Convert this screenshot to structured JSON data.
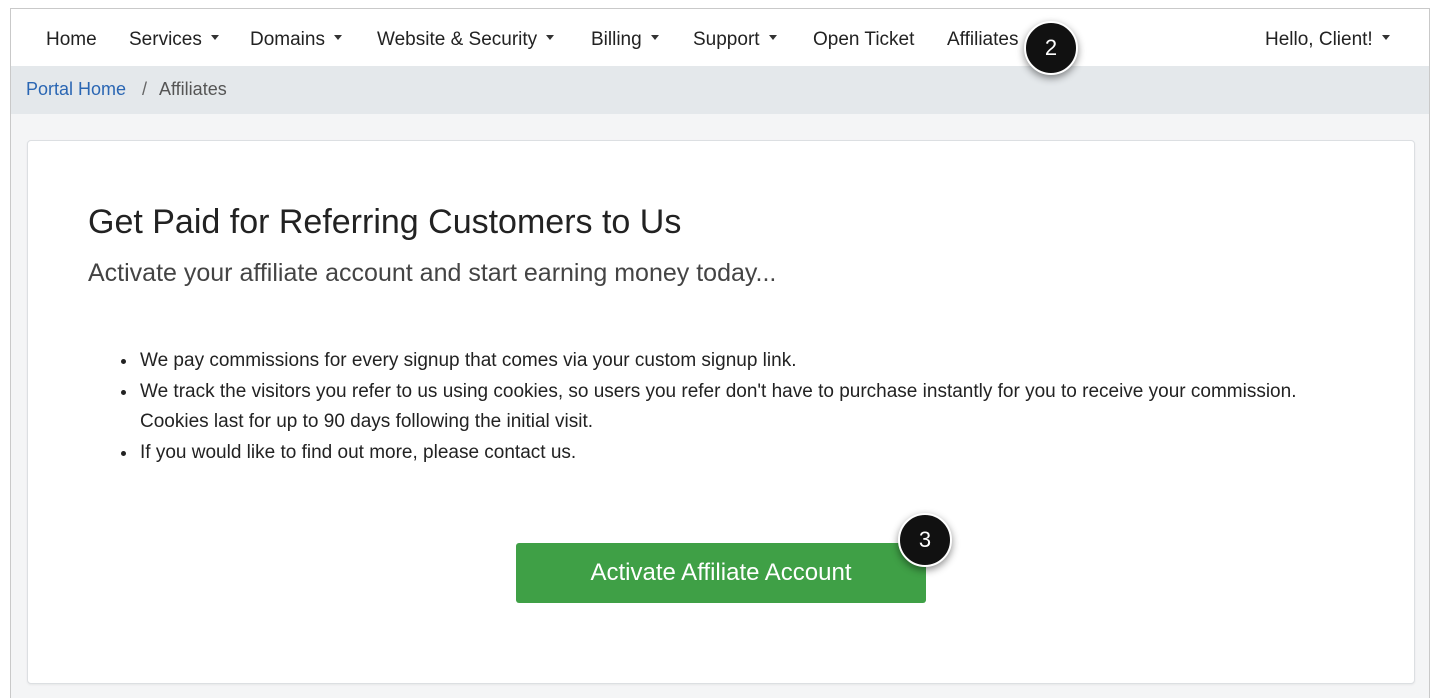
{
  "nav": {
    "home": "Home",
    "services": "Services",
    "domains": "Domains",
    "website_security": "Website & Security",
    "billing": "Billing",
    "support": "Support",
    "open_ticket": "Open Ticket",
    "affiliates": "Affiliates",
    "user_menu": "Hello, Client!"
  },
  "breadcrumb": {
    "home": "Portal Home",
    "separator": "/",
    "current": "Affiliates"
  },
  "content": {
    "title": "Get Paid for Referring Customers to Us",
    "subtitle": "Activate your affiliate account and start earning money today...",
    "bullets": [
      "We pay commissions for every signup that comes via your custom signup link.",
      "We track the visitors you refer to us using cookies, so users you refer don't have to purchase instantly for you to receive your commission. Cookies last for up to 90 days following the initial visit.",
      "If you would like to find out more, please contact us."
    ],
    "activate_button": "Activate Affiliate Account"
  },
  "annotations": {
    "step_2": "2",
    "step_3": "3"
  },
  "colors": {
    "link": "#2a66b3",
    "button": "#3fa046",
    "breadcrumb_bg": "#e4e8eb"
  }
}
